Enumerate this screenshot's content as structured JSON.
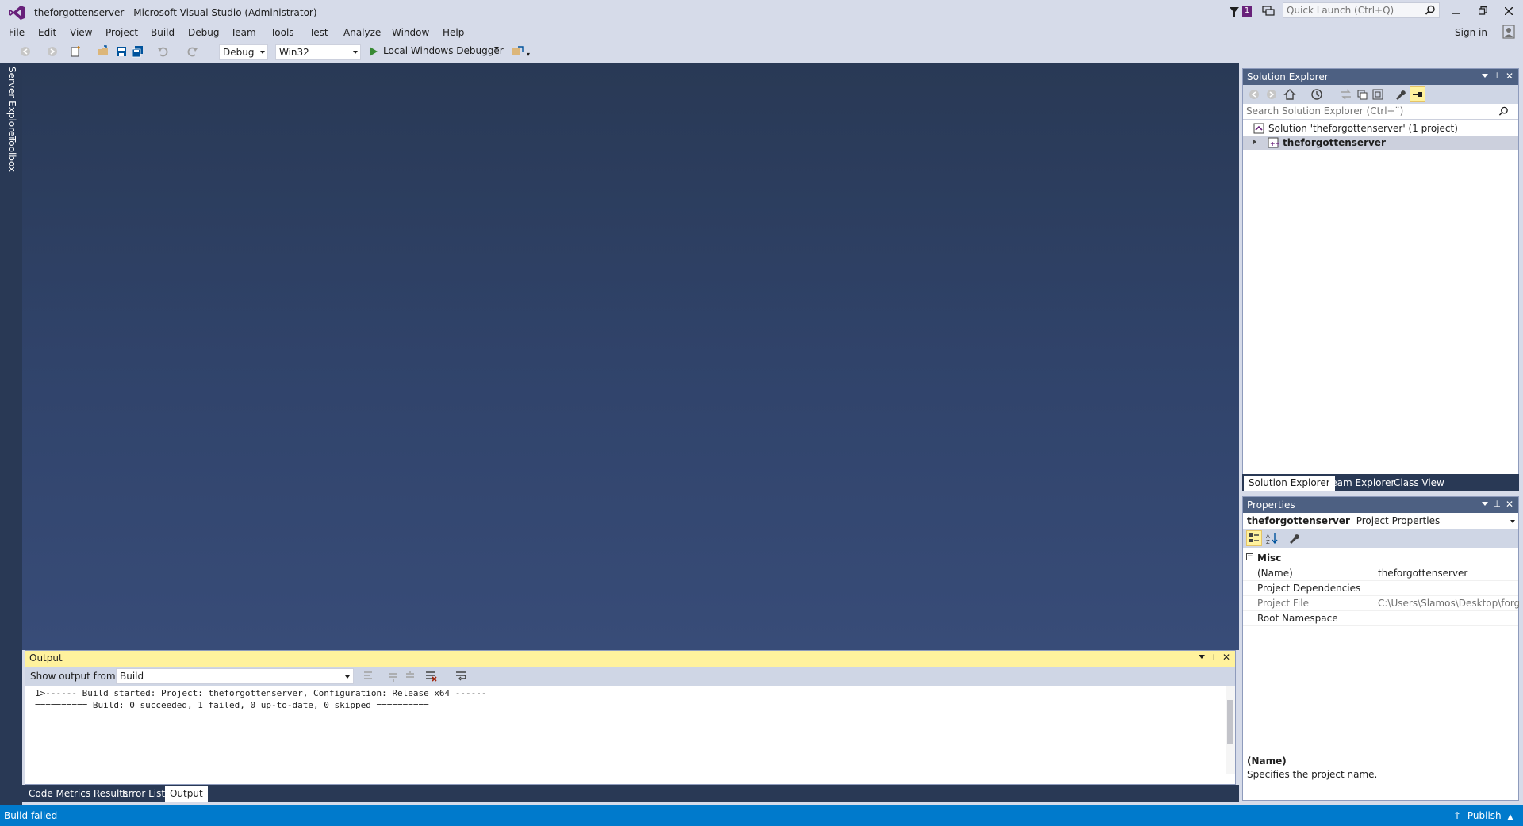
{
  "window": {
    "title": "theforgottenserver - Microsoft Visual Studio (Administrator)",
    "notification_count": "1",
    "quick_launch_placeholder": "Quick Launch (Ctrl+Q)",
    "sign_in": "Sign in"
  },
  "menu": [
    "File",
    "Edit",
    "View",
    "Project",
    "Build",
    "Debug",
    "Team",
    "Tools",
    "Test",
    "Analyze",
    "Window",
    "Help"
  ],
  "toolbar": {
    "configuration": "Debug",
    "platform": "Win32",
    "debugger": "Local Windows Debugger"
  },
  "side_tabs": [
    "Server Explorer",
    "Toolbox"
  ],
  "output": {
    "title": "Output",
    "show_from_label": "Show output from:",
    "source": "Build",
    "lines": [
      "1>------ Build started: Project: theforgottenserver, Configuration: Release x64 ------",
      "========== Build: 0 succeeded, 1 failed, 0 up-to-date, 0 skipped =========="
    ]
  },
  "bottom_tabs": [
    "Code Metrics Results",
    "Error List",
    "Output"
  ],
  "solution_explorer": {
    "title": "Solution Explorer",
    "search_placeholder": "Search Solution Explorer (Ctrl+¨)",
    "solution": "Solution 'theforgottenserver' (1 project)",
    "project": "theforgottenserver",
    "tabs": [
      "Solution Explorer",
      "Team Explorer",
      "Class View"
    ]
  },
  "properties": {
    "title": "Properties",
    "object_name": "theforgottenserver",
    "object_type": "Project Properties",
    "category": "Misc",
    "rows": [
      {
        "name": "(Name)",
        "value": "theforgottenserver"
      },
      {
        "name": "Project Dependencies",
        "value": ""
      },
      {
        "name": "Project File",
        "value": "C:\\Users\\Slamos\\Desktop\\forgot"
      },
      {
        "name": "Root Namespace",
        "value": ""
      }
    ],
    "desc_title": "(Name)",
    "desc_text": "Specifies the project name."
  },
  "status": {
    "text": "Build failed",
    "publish": "Publish"
  },
  "colors": {
    "accent": "#007acc",
    "editor_bg": "#293955",
    "output_header": "#fff29d",
    "pane_header": "#4d6082"
  }
}
